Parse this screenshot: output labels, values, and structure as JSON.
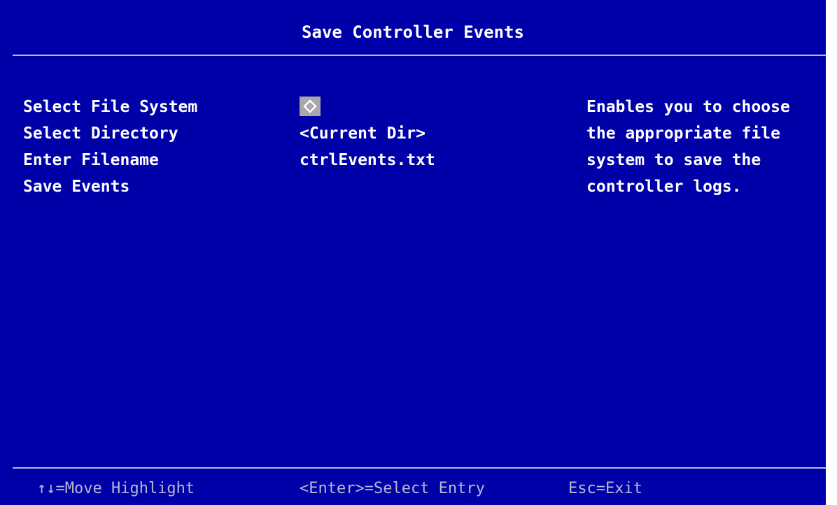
{
  "title": "Save Controller Events",
  "menu": {
    "items": [
      {
        "label": "Select File System"
      },
      {
        "label": "Select Directory"
      },
      {
        "label": "Enter Filename"
      },
      {
        "label": "Save Events"
      }
    ]
  },
  "values": {
    "file_system_icon": "selector-diamond-icon",
    "directory": "<Current Dir>",
    "filename": "ctrlEvents.txt"
  },
  "help": {
    "lines": [
      "Enables you to choose",
      "the appropriate file",
      "system to save the",
      "controller logs."
    ]
  },
  "footer": {
    "move": "↑↓=Move Highlight",
    "select": "<Enter>=Select Entry",
    "exit": "Esc=Exit"
  },
  "colors": {
    "background": "#0000a8",
    "text": "#ffffff",
    "footer_text": "#b9b9d4",
    "highlight": "#a8a8a8"
  }
}
